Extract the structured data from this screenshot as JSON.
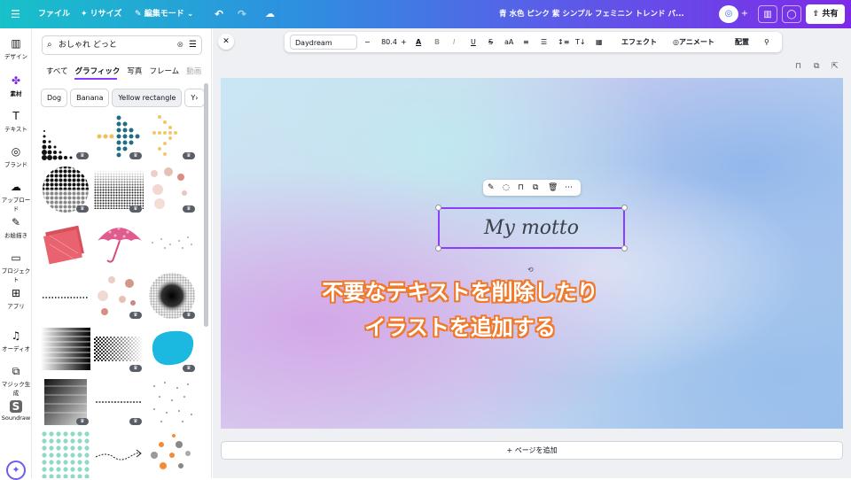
{
  "topbar": {
    "menu_icon": "hamburger-icon",
    "file": "ファイル",
    "resize": "✦ リサイズ",
    "edit_mode": "編集モード",
    "undo_icon": "undo-icon",
    "redo_icon": "redo-icon",
    "cloud_icon": "cloud-icon",
    "doc_title": "青 水色 ピンク 紫 シンプル フェミニン トレンド パ...",
    "share": "共有",
    "avatar_icon": "avatar-icon",
    "plus_icon": "plus-icon",
    "chart_icon": "insights-icon",
    "comment_icon": "comment-icon",
    "share_icon": "share-upload-icon"
  },
  "rail": [
    {
      "label": "デザイン",
      "icon": "layout-icon",
      "glyph": "▥"
    },
    {
      "label": "素材",
      "icon": "elements-icon",
      "glyph": "✤"
    },
    {
      "label": "テキスト",
      "icon": "text-icon",
      "glyph": "T"
    },
    {
      "label": "ブランド",
      "icon": "brand-icon",
      "glyph": "◎"
    },
    {
      "label": "アップロード",
      "icon": "upload-cloud-icon",
      "glyph": "☁"
    },
    {
      "label": "お絵描き",
      "icon": "pen-icon",
      "glyph": "✎"
    },
    {
      "label": "プロジェクト",
      "icon": "folder-icon",
      "glyph": "▭"
    },
    {
      "label": "アプリ",
      "icon": "apps-icon",
      "glyph": "⊞"
    },
    {
      "label": "オーディオ",
      "icon": "music-icon",
      "glyph": "♫"
    },
    {
      "label": "マジック生成",
      "icon": "magic-media-icon",
      "glyph": "⧉"
    },
    {
      "label": "Soundraw",
      "icon": "soundraw-icon",
      "glyph": "S"
    }
  ],
  "panel": {
    "search_value": "おしゃれ どっと",
    "search_icon": "search-icon",
    "clear_icon": "clear-icon",
    "filter_icon": "filter-icon",
    "tabs": [
      "すべて",
      "グラフィック",
      "写真",
      "フレーム",
      "動画"
    ],
    "active_tab": "グラフィック",
    "chips": [
      "Dog",
      "Banana",
      "Yellow rectangle",
      "Y›"
    ],
    "crown": "♛"
  },
  "toolbar": {
    "font": "Daydream",
    "minus": "−",
    "size": "80.4",
    "plus": "+",
    "effect": "エフェクト",
    "animate": "アニメート",
    "position": "配置"
  },
  "canvas": {
    "text": "My motto",
    "caption_line1": "不要なテキストを削除したり",
    "caption_line2": "イラストを追加する"
  },
  "close_icon": "close-icon",
  "add_page": "+ ページを追加"
}
